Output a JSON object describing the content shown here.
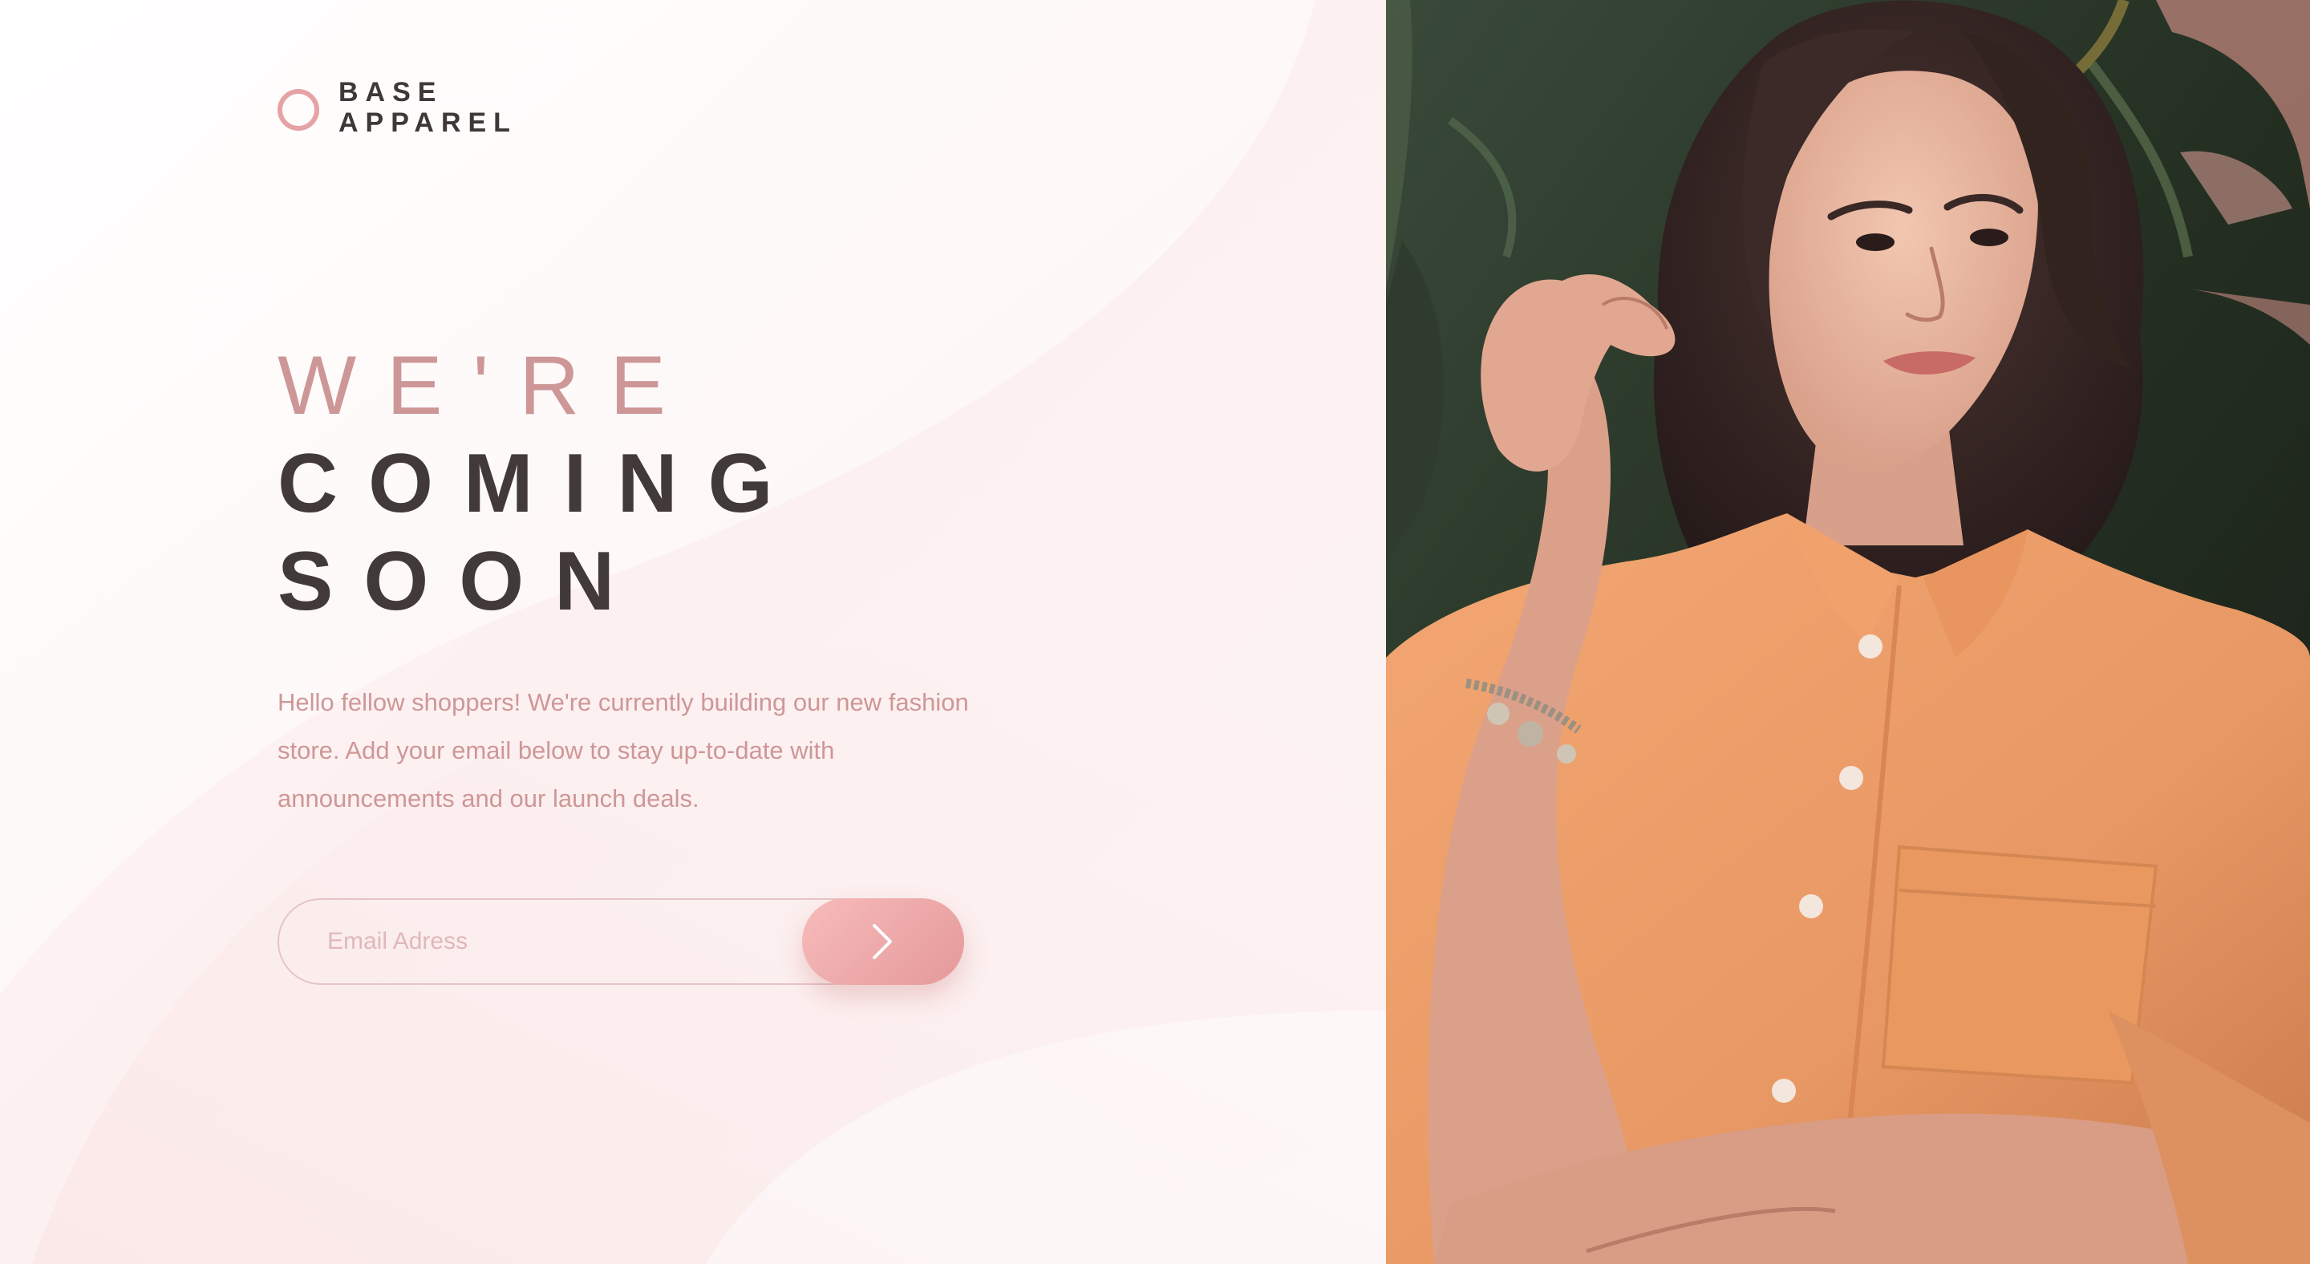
{
  "brand": {
    "line1": "BASE",
    "line2": "APPAREL",
    "logo_icon": "circle-ring-icon",
    "accent_color": "#e6a3a6"
  },
  "hero": {
    "headline_light": "WE'RE",
    "headline_dark_1": "COMING",
    "headline_dark_2": "SOON",
    "description": "Hello fellow shoppers! We're currently building our new fashion store. Add your email below to stay up-to-date with announcements and our launch deals."
  },
  "form": {
    "email_placeholder": "Email Adress",
    "email_value": "",
    "submit_icon": "chevron-right-icon",
    "submit_gradient": [
      "#f7bbbb",
      "#e5999a"
    ]
  },
  "image": {
    "subject": "hero-photo"
  },
  "colors": {
    "desaturated_red": "#ce9797",
    "dark_grayish_red": "#423a3a",
    "background": "#fdf6f6"
  }
}
